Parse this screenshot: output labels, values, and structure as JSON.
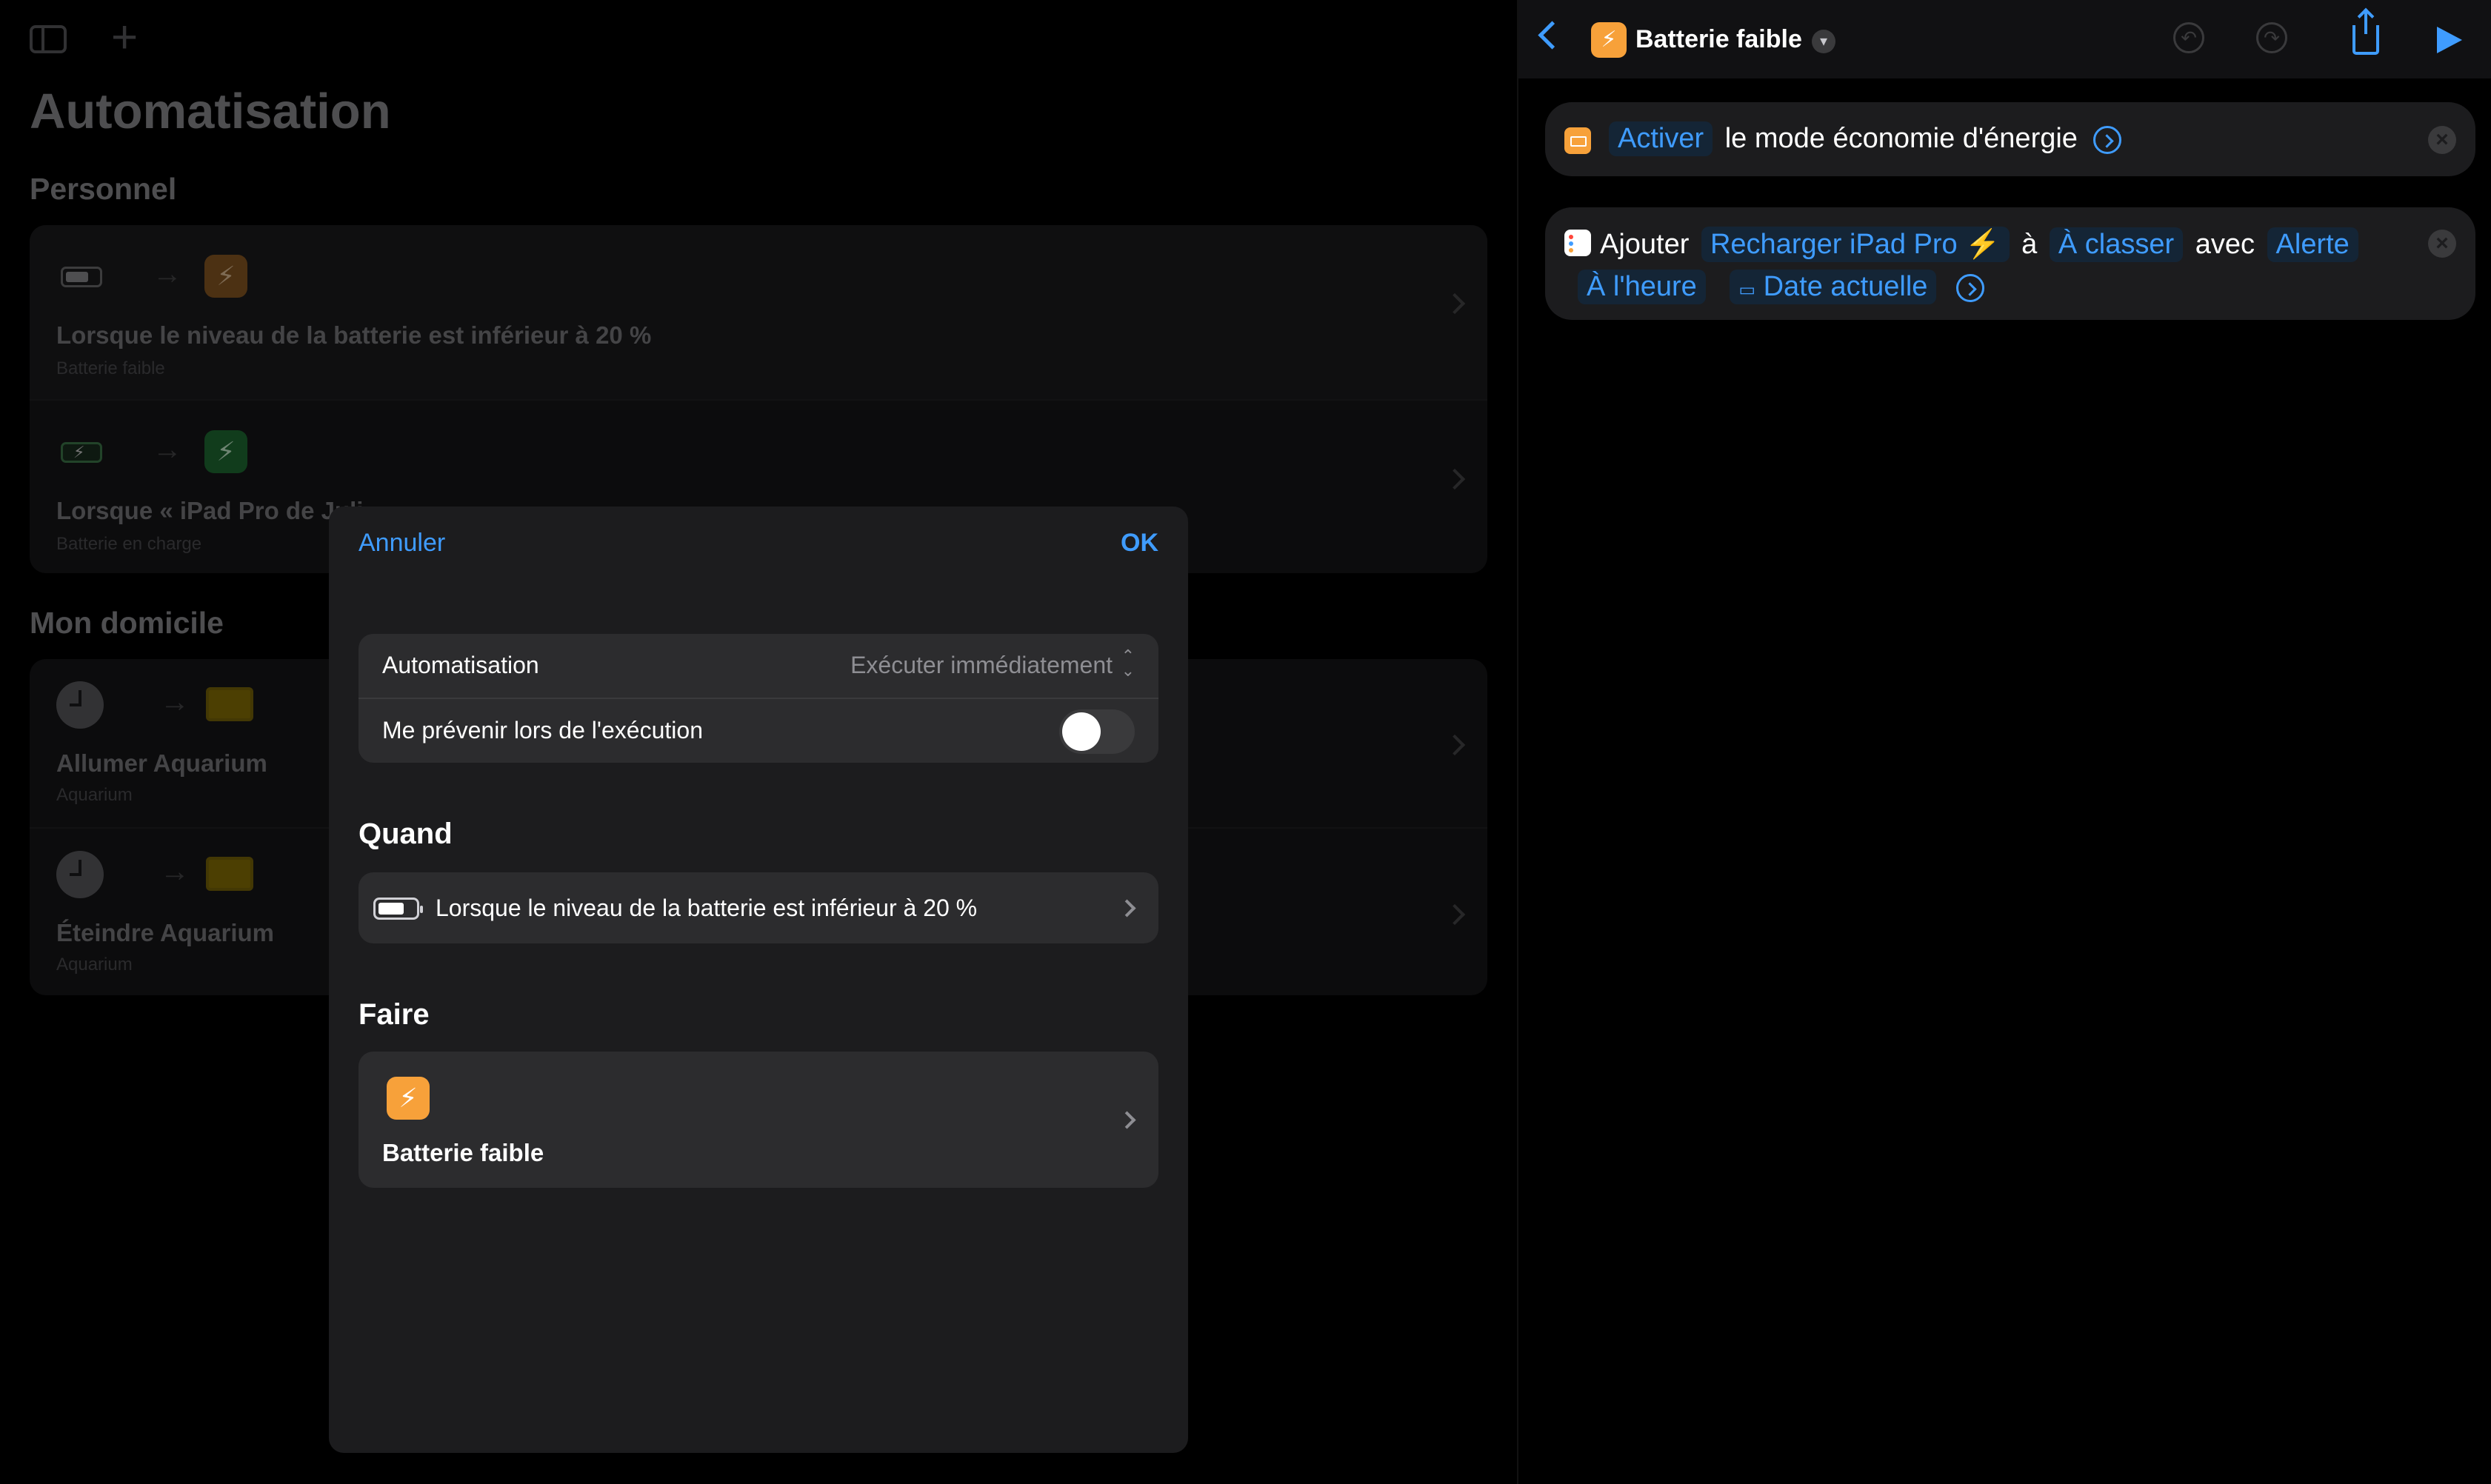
{
  "left": {
    "title": "Automatisation",
    "sections": [
      {
        "title": "Personnel",
        "rows": [
          {
            "title": "Lorsque le niveau de la batterie est inférieur à 20 %",
            "subtitle": "Batterie faible"
          },
          {
            "title": "Lorsque « iPad Pro de Juli",
            "subtitle": "Batterie en charge"
          }
        ]
      },
      {
        "title": "Mon domicile",
        "rows": [
          {
            "title": "Allumer Aquarium",
            "subtitle": "Aquarium"
          },
          {
            "title": "Éteindre Aquarium",
            "subtitle": "Aquarium"
          }
        ]
      }
    ]
  },
  "right": {
    "shortcut_name": "Batterie faible",
    "action1": {
      "verb": "Activer",
      "text": "le mode économie d'énergie"
    },
    "action2": {
      "verb": "Ajouter",
      "item": "Recharger iPad Pro ⚡️",
      "prep1": "à",
      "list": "À classer",
      "prep2": "avec",
      "alert": "Alerte",
      "timing": "À l'heure",
      "date": "Date actuelle"
    }
  },
  "modal": {
    "cancel": "Annuler",
    "ok": "OK",
    "settings": {
      "automation_label": "Automatisation",
      "automation_value": "Exécuter immédiatement",
      "notify_label": "Me prévenir lors de l'exécution",
      "notify_on": false
    },
    "when": {
      "title": "Quand",
      "trigger": "Lorsque le niveau de la batterie est inférieur à 20 %"
    },
    "do": {
      "title": "Faire",
      "shortcut": "Batterie faible"
    }
  },
  "colors": {
    "accent": "#3f9cff",
    "orange": "#f7a13a",
    "green": "#30d158",
    "yellow": "#ffd60a"
  }
}
